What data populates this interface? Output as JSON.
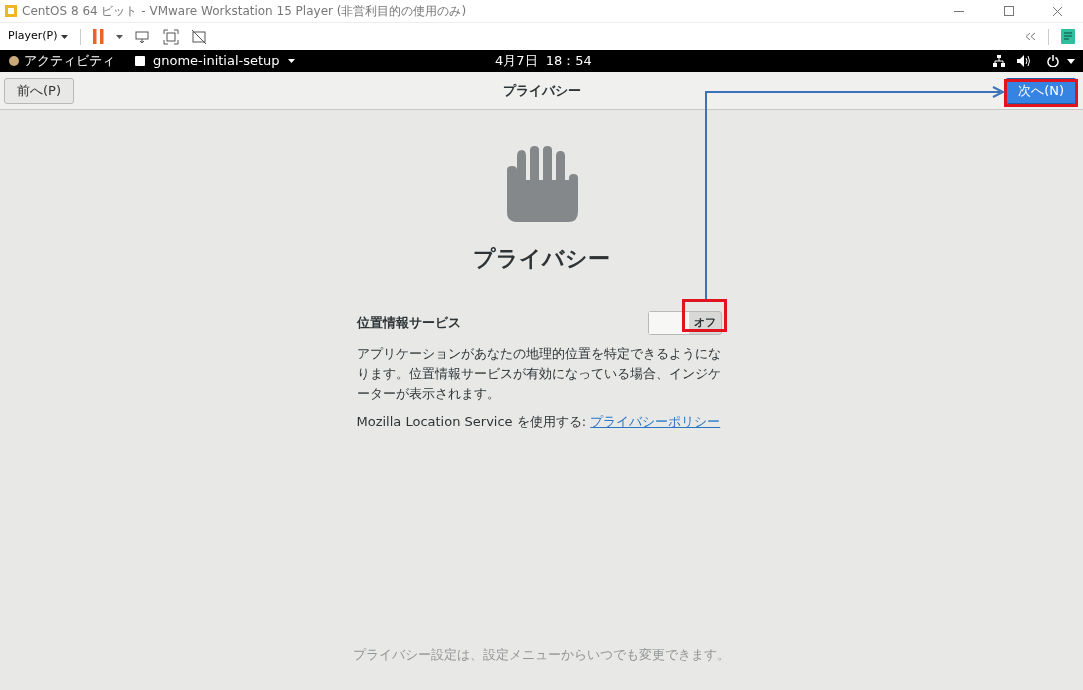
{
  "window": {
    "title": "CentOS 8 64 ビット - VMware Workstation 15 Player (非営利目的の使用のみ)"
  },
  "toolbar": {
    "player_menu": "Player(P)"
  },
  "top_bar": {
    "activities": "アクティビティ",
    "app_menu": "gnome-initial-setup",
    "clock": "4月7日  18：54"
  },
  "header": {
    "back_button": "前へ(P)",
    "title": "プライバシー",
    "next_button": "次へ(N)"
  },
  "page": {
    "heading": "プライバシー",
    "location_service": {
      "label": "位置情報サービス",
      "on": false,
      "state_label": "オフ"
    },
    "description": "アプリケーションがあなたの地理的位置を特定できるようになります。位置情報サービスが有効になっている場合、インジケーターが表示されます。",
    "mozilla_text": "Mozilla Location Service を使用する: ",
    "policy_link": "プライバシーポリシー",
    "footer": "プライバシー設定は、設定メニューからいつでも変更できます。"
  }
}
